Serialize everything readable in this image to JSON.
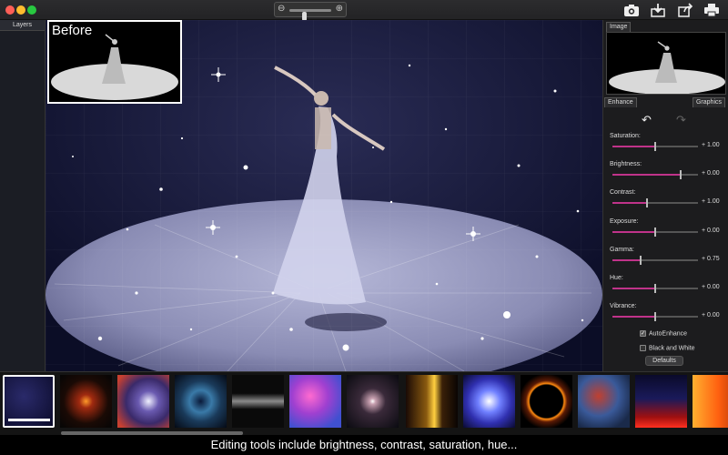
{
  "toolbar": {
    "zoom_out_icon": "magnifier-minus",
    "zoom_in_icon": "magnifier-plus",
    "zoom_level": 0.35,
    "icons": [
      "camera-add-icon",
      "export-icon",
      "share-icon",
      "print-icon"
    ]
  },
  "layers_panel": {
    "title": "Layers"
  },
  "canvas": {
    "before_label": "Before"
  },
  "right_panel": {
    "tabs": {
      "image": "Image",
      "enhance": "Enhance",
      "graphics": "Graphics"
    },
    "sliders": [
      {
        "label": "Saturation:",
        "value": "+ 1.00",
        "level": 0.5
      },
      {
        "label": "Brightness:",
        "value": "+ 0.00",
        "level": 0.8
      },
      {
        "label": "Contrast:",
        "value": "+ 1.00",
        "level": 0.4
      },
      {
        "label": "Exposure:",
        "value": "+ 0.00",
        "level": 0.5
      },
      {
        "label": "Gamma:",
        "value": "+ 0.75",
        "level": 0.33
      },
      {
        "label": "Hue:",
        "value": "+ 0.00",
        "level": 0.5
      },
      {
        "label": "Vibrance:",
        "value": "+ 0.00",
        "level": 0.5
      }
    ],
    "auto_enhance": {
      "label": "AutoEnhance",
      "checked": true
    },
    "black_white": {
      "label": "Black and White",
      "checked": false
    },
    "defaults_button": "Defaults"
  },
  "caption": "Editing tools include brightness, contrast, saturation, hue..."
}
